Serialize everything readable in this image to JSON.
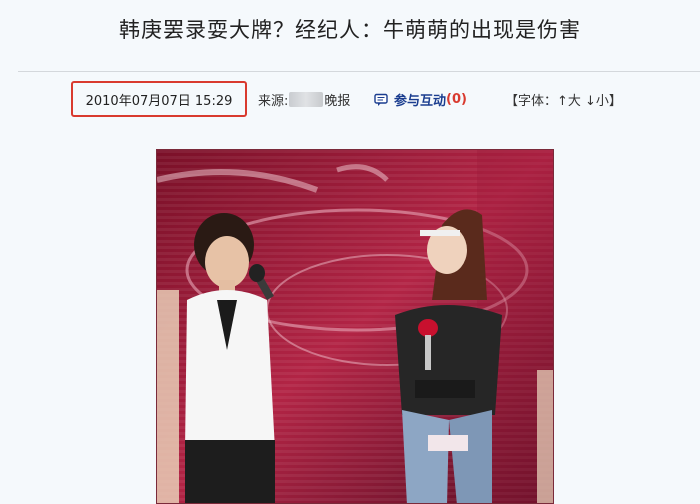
{
  "article": {
    "headline": "韩庚罢录耍大牌？经纪人：牛萌萌的出现是伤害",
    "date": "2010年07月07日 15:29",
    "source_label": "来源:",
    "source_name": "晚报",
    "interact_label": "参与互动",
    "interact_count": "(0)",
    "font_control": "【字体：↑大 ↓小】"
  },
  "icons": {
    "interact": "comment-bubble-icon"
  },
  "colors": {
    "highlight_border": "#d93a2f",
    "link_blue": "#1a3d8f",
    "count_red": "#d93a2f",
    "page_bg": "#f5f9fc"
  }
}
